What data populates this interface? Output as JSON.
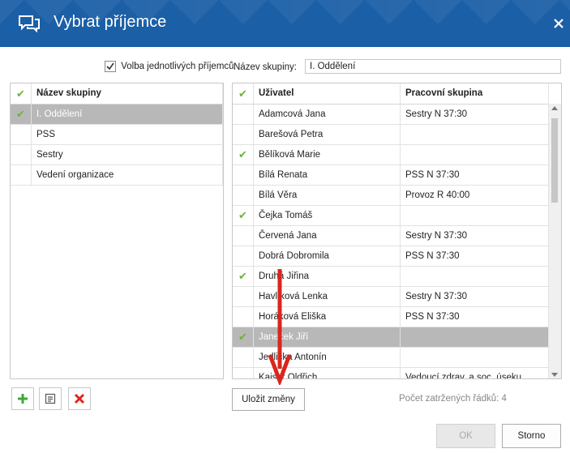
{
  "window": {
    "title": "Vybrat příjemce"
  },
  "options": {
    "individual_recipients_label": "Volba jednotlivých příjemců",
    "individual_recipients_checked": true,
    "group_name_label": "Název skupiny:",
    "group_name_value": "I. Oddělení"
  },
  "groups_grid": {
    "header": "Název skupiny",
    "rows": [
      {
        "name": "I. Oddělení",
        "checked": true,
        "selected": true
      },
      {
        "name": "PSS",
        "checked": false
      },
      {
        "name": "Sestry",
        "checked": false
      },
      {
        "name": "Vedení organizace",
        "checked": false
      }
    ]
  },
  "users_grid": {
    "headers": {
      "user": "Uživatel",
      "group": "Pracovní skupina"
    },
    "rows": [
      {
        "user": "Adamcová Jana",
        "group": "Sestry N 37:30",
        "checked": false
      },
      {
        "user": "Barešová Petra",
        "group": "",
        "checked": false
      },
      {
        "user": "Bělíková Marie",
        "group": "",
        "checked": true
      },
      {
        "user": "Bílá Renata",
        "group": "PSS N 37:30",
        "checked": false
      },
      {
        "user": "Bílá Věra",
        "group": "Provoz R 40:00",
        "checked": false
      },
      {
        "user": "Čejka Tomáš",
        "group": "",
        "checked": true
      },
      {
        "user": "Červená Jana",
        "group": "Sestry N 37:30",
        "checked": false
      },
      {
        "user": "Dobrá Dobromila",
        "group": "PSS N 37:30",
        "checked": false
      },
      {
        "user": "Druhá Jiřina",
        "group": "",
        "checked": true
      },
      {
        "user": "Havlíková Lenka",
        "group": "Sestry N 37:30",
        "checked": false
      },
      {
        "user": "Horáková Eliška",
        "group": "PSS N 37:30",
        "checked": false
      },
      {
        "user": "Janeček Jiří",
        "group": "",
        "checked": true,
        "selected": true
      },
      {
        "user": "Jedlička Antonín",
        "group": "",
        "checked": false
      },
      {
        "user": "Kaiser Oldřich",
        "group": "Vedoucí zdrav. a soc. úseku",
        "checked": false
      }
    ]
  },
  "toolbar": {
    "add_icon": "plus-icon",
    "edit_icon": "edit-icon",
    "delete_icon": "delete-icon"
  },
  "buttons": {
    "save": "Uložit změny",
    "ok": "OK",
    "cancel": "Storno"
  },
  "status": {
    "marked_rows": "Počet zatržených řádků: 4"
  },
  "colors": {
    "titlebar": "#1b5fa6",
    "check": "#6cb33e",
    "selected_row": "#b8b8b8",
    "arrow": "#d9261c"
  }
}
